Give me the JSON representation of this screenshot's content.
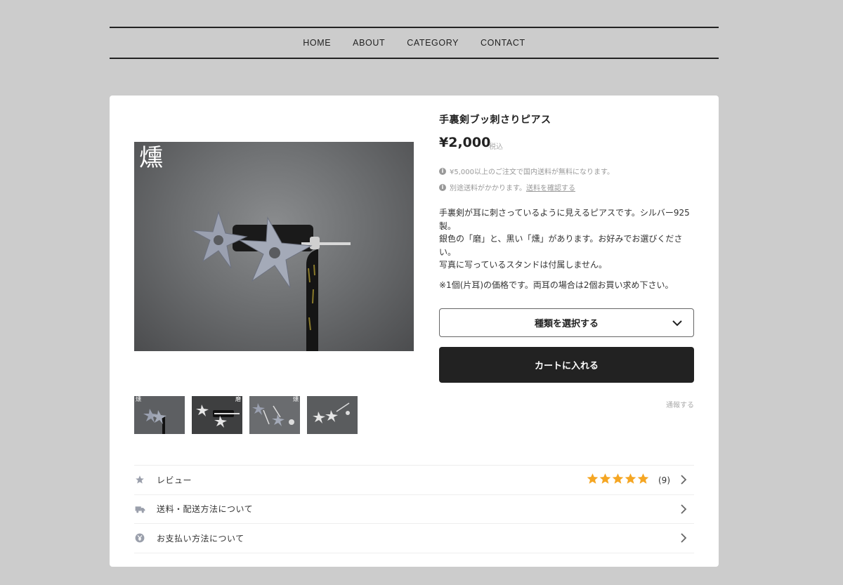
{
  "nav": {
    "items": [
      "HOME",
      "ABOUT",
      "CATEGORY",
      "CONTACT"
    ]
  },
  "product": {
    "title": "手裏剣ブッ刺さりピアス",
    "price": "¥2,000",
    "tax_label": "税込",
    "shipping_notes": [
      {
        "text": "¥5,000以上のご注文で国内送料が無料になります。",
        "link": ""
      },
      {
        "text": "別途送料がかかります。",
        "link": "送料を確認する"
      }
    ],
    "description": [
      "手裏剣が耳に刺さっているように見えるピアスです。シルバー925製。",
      "銀色の「磨」と、黒い「燻」があります。お好みでお選びください。",
      "写真に写っているスタンドは付属しません。"
    ],
    "description_note": "※1個(片耳)の価格です。両耳の場合は2個お買い求め下さい。",
    "select_label": "種類を選択する",
    "cart_button": "カートに入れる",
    "report_link": "通報する"
  },
  "gallery": {
    "main_stamp": "燻",
    "thumb_marks": [
      "燻",
      "磨",
      "燻",
      ""
    ]
  },
  "info_rows": [
    {
      "label": "レビュー",
      "icon": "star-icon",
      "rating": 5,
      "count": "(9)"
    },
    {
      "label": "送料・配送方法について",
      "icon": "truck-icon"
    },
    {
      "label": "お支払い方法について",
      "icon": "yen-icon"
    }
  ],
  "colors": {
    "page_bg": "#cccccc",
    "card_bg": "#ffffff",
    "primary_button": "#222222",
    "star": "#f5a623",
    "muted_text": "#999999"
  }
}
